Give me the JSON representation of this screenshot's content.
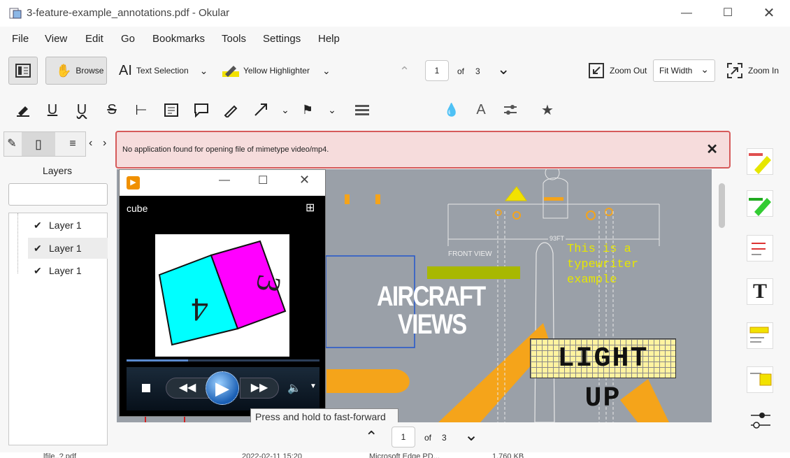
{
  "window": {
    "title": "3-feature-example_annotations.pdf  - Okular"
  },
  "menu": [
    "File",
    "View",
    "Edit",
    "Go",
    "Bookmarks",
    "Tools",
    "Settings",
    "Help"
  ],
  "toolbar": {
    "browse": "Browse",
    "text_selection": "Text Selection",
    "highlighter": "Yellow Highlighter",
    "page": "1",
    "of": "of",
    "total": "3",
    "zoom_out": "Zoom Out",
    "zoom_mode": "Fit Width",
    "zoom_in": "Zoom In"
  },
  "sidebar": {
    "title": "Layers",
    "search_placeholder": "",
    "layers": [
      {
        "label": "Layer 1",
        "checked": true
      },
      {
        "label": "Layer 1",
        "checked": true
      },
      {
        "label": "Layer 1",
        "checked": true
      }
    ]
  },
  "notice": {
    "message": "No application found for opening file of mimetype video/mp4."
  },
  "media": {
    "name": "cube",
    "tooltip": "Press and hold to fast-forward"
  },
  "pdf": {
    "heading1": "AIRCRAFT",
    "heading2": "VIEWS",
    "front_view": "FRONT VIEW",
    "dimension": "93FT",
    "typewriter": [
      "This is a",
      "typewriter",
      "example"
    ],
    "stamp": "LIGHT UP"
  },
  "bottom": {
    "page": "1",
    "of": "of",
    "total": "3"
  },
  "taskbar": {
    "fragment1": "lfile..?.pdf",
    "fragment2": "2022-02-11 15:20",
    "fragment3": "Microsoft Edge PD...",
    "fragment4": "1,760 KB"
  },
  "colors": {
    "accent_red": "#d94040",
    "highlight_yellow": "#f2e200",
    "notice_bg": "#f6dcdc"
  }
}
